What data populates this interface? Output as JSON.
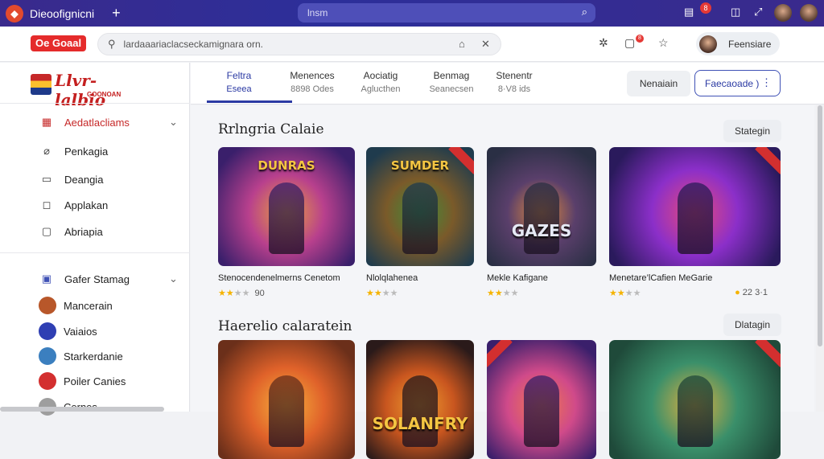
{
  "window": {
    "tab_title": "Dieoofignicni",
    "url": "lnsm",
    "badge": "8"
  },
  "header": {
    "logo": "Oe Goaal",
    "search_placeholder": "lardaaariaclacseckamignara orn.",
    "badge": "8",
    "profile_name": "Feensiare"
  },
  "sidebar": {
    "brand": "Llvr-lalbio",
    "brand_sub": "GOONOAN",
    "nav": [
      {
        "label": "Aedatlacliams",
        "icon": "grid-icon",
        "active": true
      },
      {
        "label": "Penkagia",
        "icon": "tag-icon"
      },
      {
        "label": "Deangia",
        "icon": "folder-icon"
      },
      {
        "label": "Applakan",
        "icon": "shield-icon"
      },
      {
        "label": "Abriapia",
        "icon": "bookmark-icon"
      }
    ],
    "games_header": "Gafer Stamag",
    "games": [
      {
        "label": "Mancerain",
        "color": "#b8572a"
      },
      {
        "label": "Vaiaios",
        "color": "#2f3fb3"
      },
      {
        "label": "Starkerdanie",
        "color": "#3b7fbf"
      },
      {
        "label": "Poiler Canies",
        "color": "#d32f2f"
      },
      {
        "label": "Cernes",
        "color": "#9e9e9e"
      }
    ]
  },
  "tabs": [
    {
      "line1": "Feltra",
      "line2": "Eseea"
    },
    {
      "line1": "Menences",
      "line2": "8898 Odes"
    },
    {
      "line1": "Aociatig",
      "line2": "Aglucthen"
    },
    {
      "line1": "Benmag",
      "line2": "Seanecsen"
    },
    {
      "line1": "Stenentr",
      "line2": "8·V8 ids"
    }
  ],
  "actions": {
    "plain": "Nenaiain",
    "outline": "Faecaoade )"
  },
  "sections": [
    {
      "title": "Rrlngria Calaie",
      "button": "Stategin",
      "cards": [
        {
          "name": "Stenocendenelmerns Cenetom",
          "stars": 2,
          "rating": "90",
          "art_text": "DUNRAS",
          "colors": [
            "#3a1f6b",
            "#b8408d",
            "#e9a13b"
          ]
        },
        {
          "name": "Nlolqlahenea",
          "stars": 2,
          "rating": "",
          "art_text": "SUMDER",
          "colors": [
            "#1f3b4d",
            "#7a5a2a",
            "#3e8f3a"
          ]
        },
        {
          "name": "Mekle Kafigane",
          "stars": 2,
          "rating": "",
          "art_text": "GAZES",
          "colors": [
            "#2a2f44",
            "#5a3f6b",
            "#e08a3a"
          ]
        },
        {
          "name": "Menetare’lCafien MeGarie",
          "stars": 2,
          "rating": "22 3·1",
          "art_text": "",
          "colors": [
            "#2a1a5c",
            "#8b2fc9",
            "#e84a7a"
          ]
        }
      ]
    },
    {
      "title": "Haerelio calaratein",
      "button": "Dlatagin",
      "cards": [
        {
          "name": "",
          "stars": 0,
          "rating": "",
          "art_text": "",
          "colors": [
            "#6b2f1a",
            "#e0622a",
            "#f6b23c"
          ]
        },
        {
          "name": "",
          "stars": 0,
          "rating": "",
          "art_text": "SOLANFRY",
          "colors": [
            "#2a1a1a",
            "#c9561f",
            "#f0a030"
          ]
        },
        {
          "name": "",
          "stars": 0,
          "rating": "",
          "art_text": "",
          "colors": [
            "#3a1f6b",
            "#d04a8a",
            "#f07a4a"
          ]
        },
        {
          "name": "",
          "stars": 0,
          "rating": "",
          "art_text": "",
          "colors": [
            "#1f4a3a",
            "#3a8f6a",
            "#e0b040"
          ]
        }
      ]
    }
  ]
}
